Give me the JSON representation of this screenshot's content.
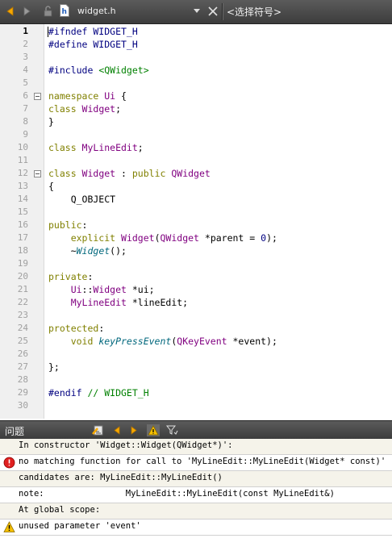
{
  "toolbar": {
    "file_name": "widget.h",
    "symbol_selector": "<选择符号>"
  },
  "editor": {
    "current_line": 1,
    "lines": [
      {
        "n": "1",
        "tokens": [
          {
            "t": "#ifndef WIDGET_H",
            "c": "t-pre"
          }
        ]
      },
      {
        "n": "2",
        "tokens": [
          {
            "t": "#define WIDGET_H",
            "c": "t-pre"
          }
        ]
      },
      {
        "n": "3",
        "tokens": []
      },
      {
        "n": "4",
        "tokens": [
          {
            "t": "#include ",
            "c": "t-pre"
          },
          {
            "t": "<QWidget>",
            "c": "t-str"
          }
        ]
      },
      {
        "n": "5",
        "tokens": []
      },
      {
        "n": "6",
        "fold": true,
        "tokens": [
          {
            "t": "namespace ",
            "c": "t-kw"
          },
          {
            "t": "Ui",
            "c": "t-type"
          },
          {
            "t": " {",
            "c": "t-plain"
          }
        ]
      },
      {
        "n": "7",
        "tokens": [
          {
            "t": "class ",
            "c": "t-kw"
          },
          {
            "t": "Widget",
            "c": "t-type"
          },
          {
            "t": ";",
            "c": "t-plain"
          }
        ]
      },
      {
        "n": "8",
        "tokens": [
          {
            "t": "}",
            "c": "t-plain"
          }
        ]
      },
      {
        "n": "9",
        "tokens": []
      },
      {
        "n": "10",
        "tokens": [
          {
            "t": "class ",
            "c": "t-kw"
          },
          {
            "t": "MyLineEdit",
            "c": "t-type"
          },
          {
            "t": ";",
            "c": "t-plain"
          }
        ]
      },
      {
        "n": "11",
        "tokens": []
      },
      {
        "n": "12",
        "fold": true,
        "tokens": [
          {
            "t": "class ",
            "c": "t-kw"
          },
          {
            "t": "Widget",
            "c": "t-type"
          },
          {
            "t": " : ",
            "c": "t-plain"
          },
          {
            "t": "public ",
            "c": "t-kw"
          },
          {
            "t": "QWidget",
            "c": "t-type"
          }
        ]
      },
      {
        "n": "13",
        "tokens": [
          {
            "t": "{",
            "c": "t-plain"
          }
        ]
      },
      {
        "n": "14",
        "tokens": [
          {
            "t": "    Q_OBJECT",
            "c": "t-plain"
          }
        ]
      },
      {
        "n": "15",
        "tokens": []
      },
      {
        "n": "16",
        "tokens": [
          {
            "t": "public",
            "c": "t-kw"
          },
          {
            "t": ":",
            "c": "t-plain"
          }
        ]
      },
      {
        "n": "17",
        "tokens": [
          {
            "t": "    explicit ",
            "c": "t-kw"
          },
          {
            "t": "Widget",
            "c": "t-type"
          },
          {
            "t": "(",
            "c": "t-plain"
          },
          {
            "t": "QWidget",
            "c": "t-type"
          },
          {
            "t": " *parent = ",
            "c": "t-plain"
          },
          {
            "t": "0",
            "c": "t-num"
          },
          {
            "t": ");",
            "c": "t-plain"
          }
        ]
      },
      {
        "n": "18",
        "tokens": [
          {
            "t": "    ~",
            "c": "t-plain"
          },
          {
            "t": "Widget",
            "c": "t-fn"
          },
          {
            "t": "();",
            "c": "t-plain"
          }
        ]
      },
      {
        "n": "19",
        "tokens": []
      },
      {
        "n": "20",
        "tokens": [
          {
            "t": "private",
            "c": "t-kw"
          },
          {
            "t": ":",
            "c": "t-plain"
          }
        ]
      },
      {
        "n": "21",
        "tokens": [
          {
            "t": "    Ui",
            "c": "t-type"
          },
          {
            "t": "::",
            "c": "t-plain"
          },
          {
            "t": "Widget",
            "c": "t-type"
          },
          {
            "t": " *ui;",
            "c": "t-plain"
          }
        ]
      },
      {
        "n": "22",
        "tokens": [
          {
            "t": "    MyLineEdit",
            "c": "t-type"
          },
          {
            "t": " *lineEdit;",
            "c": "t-plain"
          }
        ]
      },
      {
        "n": "23",
        "tokens": []
      },
      {
        "n": "24",
        "tokens": [
          {
            "t": "protected",
            "c": "t-kw"
          },
          {
            "t": ":",
            "c": "t-plain"
          }
        ]
      },
      {
        "n": "25",
        "tokens": [
          {
            "t": "    void ",
            "c": "t-kw"
          },
          {
            "t": "keyPressEvent",
            "c": "t-fn"
          },
          {
            "t": "(",
            "c": "t-plain"
          },
          {
            "t": "QKeyEvent",
            "c": "t-type"
          },
          {
            "t": " *event);",
            "c": "t-plain"
          }
        ]
      },
      {
        "n": "26",
        "tokens": []
      },
      {
        "n": "27",
        "tokens": [
          {
            "t": "};",
            "c": "t-plain"
          }
        ]
      },
      {
        "n": "28",
        "tokens": []
      },
      {
        "n": "29",
        "tokens": [
          {
            "t": "#endif ",
            "c": "t-pre"
          },
          {
            "t": "// WIDGET_H",
            "c": "t-cmt"
          }
        ]
      },
      {
        "n": "30",
        "tokens": []
      }
    ]
  },
  "issues_pane": {
    "title": "问题",
    "items": [
      {
        "icon": "none",
        "text": "In constructor 'Widget::Widget(QWidget*)':"
      },
      {
        "icon": "error",
        "text": "no matching function for call to 'MyLineEdit::MyLineEdit(Widget* const)'"
      },
      {
        "icon": "none",
        "text": "candidates are: MyLineEdit::MyLineEdit()"
      },
      {
        "icon": "none",
        "text": "note:                MyLineEdit::MyLineEdit(const MyLineEdit&)"
      },
      {
        "icon": "none",
        "text": "At global scope:"
      },
      {
        "icon": "warning",
        "text": "unused parameter 'event'"
      }
    ]
  }
}
